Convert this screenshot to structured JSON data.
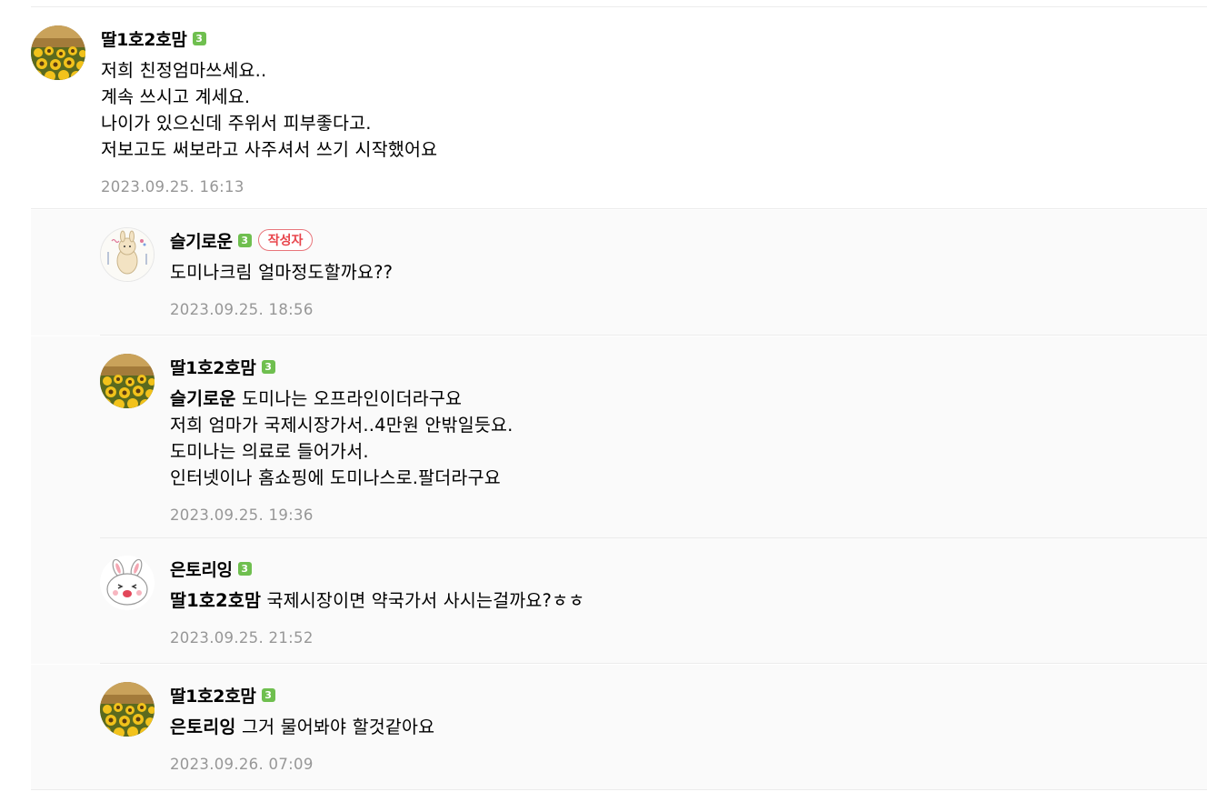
{
  "comments": [
    {
      "nickname": "딸1호2호맘",
      "level": "3",
      "writer_badge": "",
      "mention": "",
      "lines": [
        "저희 친정엄마쓰세요..",
        "계속 쓰시고 계세요.",
        "나이가 있으신데 주위서 피부좋다고.",
        "저보고도 써보라고 사주셔서 쓰기 시작했어요"
      ],
      "date": "2023.09.25. 16:13",
      "avatar": "sunflower-avatar"
    },
    {
      "nickname": "슬기로운",
      "level": "3",
      "writer_badge": "작성자",
      "mention": "",
      "lines": [
        "도미나크림 얼마정도할까요??"
      ],
      "date": "2023.09.25. 18:56",
      "avatar": "rabbit-drawing-avatar"
    },
    {
      "nickname": "딸1호2호맘",
      "level": "3",
      "writer_badge": "",
      "mention": "슬기로운",
      "lines": [
        " 도미나는 오프라인이더라구요",
        "저희 엄마가 국제시장가서..4만원 안밖일듯요.",
        "도미나는 의료로 들어가서.",
        "인터넷이나 홈쇼핑에 도미나스로.팔더라구요"
      ],
      "date": "2023.09.25. 19:36",
      "avatar": "sunflower-avatar"
    },
    {
      "nickname": "은토리잉",
      "level": "3",
      "writer_badge": "",
      "mention": "딸1호2호맘",
      "lines": [
        " 국제시장이면 약국가서 사시는걸까요?ㅎㅎ"
      ],
      "date": "2023.09.25. 21:52",
      "avatar": "white-bunny-avatar"
    },
    {
      "nickname": "딸1호2호맘",
      "level": "3",
      "writer_badge": "",
      "mention": "은토리잉",
      "lines": [
        " 그거 물어봐야 할것같아요"
      ],
      "date": "2023.09.26. 07:09",
      "avatar": "sunflower-avatar"
    }
  ]
}
